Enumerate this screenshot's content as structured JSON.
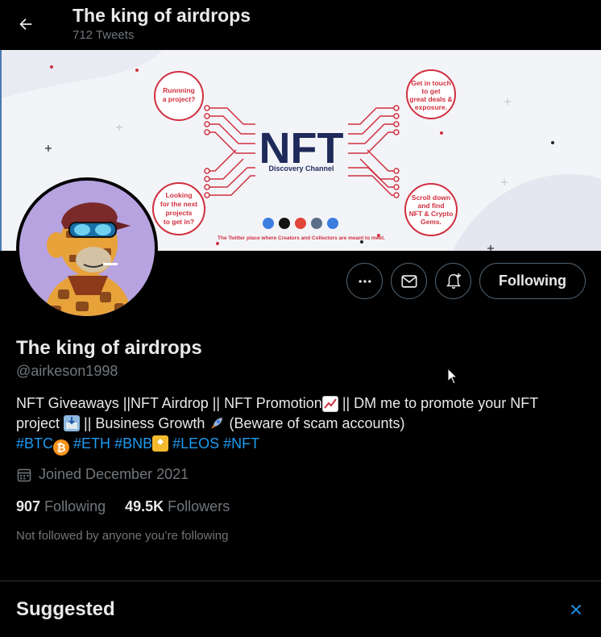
{
  "header": {
    "title": "The king of airdrops",
    "tweet_count": "712 Tweets"
  },
  "banner": {
    "logo_text": "NFT",
    "logo_sub": "Discovery Channel",
    "bubble_tl": [
      "Runnning",
      "a project?"
    ],
    "bubble_bl": [
      "Looking",
      "for the next",
      "projects",
      "to get in?"
    ],
    "bubble_tr": [
      "Get in touch",
      "to get",
      "great deals &",
      "exposure."
    ],
    "bubble_br": [
      "Scroll down",
      "and find",
      "NFT & Crypto",
      "Gems."
    ],
    "tagline": "The Twitter place where Creators and Collectors are meant to meet."
  },
  "actions": {
    "more_icon": "more-icon",
    "message_icon": "mail-icon",
    "notify_icon": "bell-plus-icon",
    "follow_label": "Following"
  },
  "profile": {
    "name": "The king of airdrops",
    "handle": "@airkeson1998",
    "bio_line1": "NFT Giveaways ||NFT Airdrop || NFT Promotion",
    "bio_line1b": " || DM me to promote your NFT",
    "bio_line2a": "project ",
    "bio_line2b": " || Business Growth ",
    "bio_line2c": "  (Beware of scam accounts)",
    "hashtags": [
      "#BTC",
      "#ETH",
      "#BNB",
      "#LEOS",
      "#NFT"
    ],
    "joined": "Joined December 2021",
    "following_count": "907",
    "following_label": "Following",
    "followers_count": "49.5K",
    "followers_label": "Followers",
    "not_followed": "Not followed by anyone you’re following"
  },
  "suggested": {
    "title": "Suggested"
  },
  "colors": {
    "accent": "#1d9bf0",
    "banner_red": "#d0303f",
    "banner_navy": "#1f2a5a",
    "avatar_bg": "#b7a3e0"
  }
}
